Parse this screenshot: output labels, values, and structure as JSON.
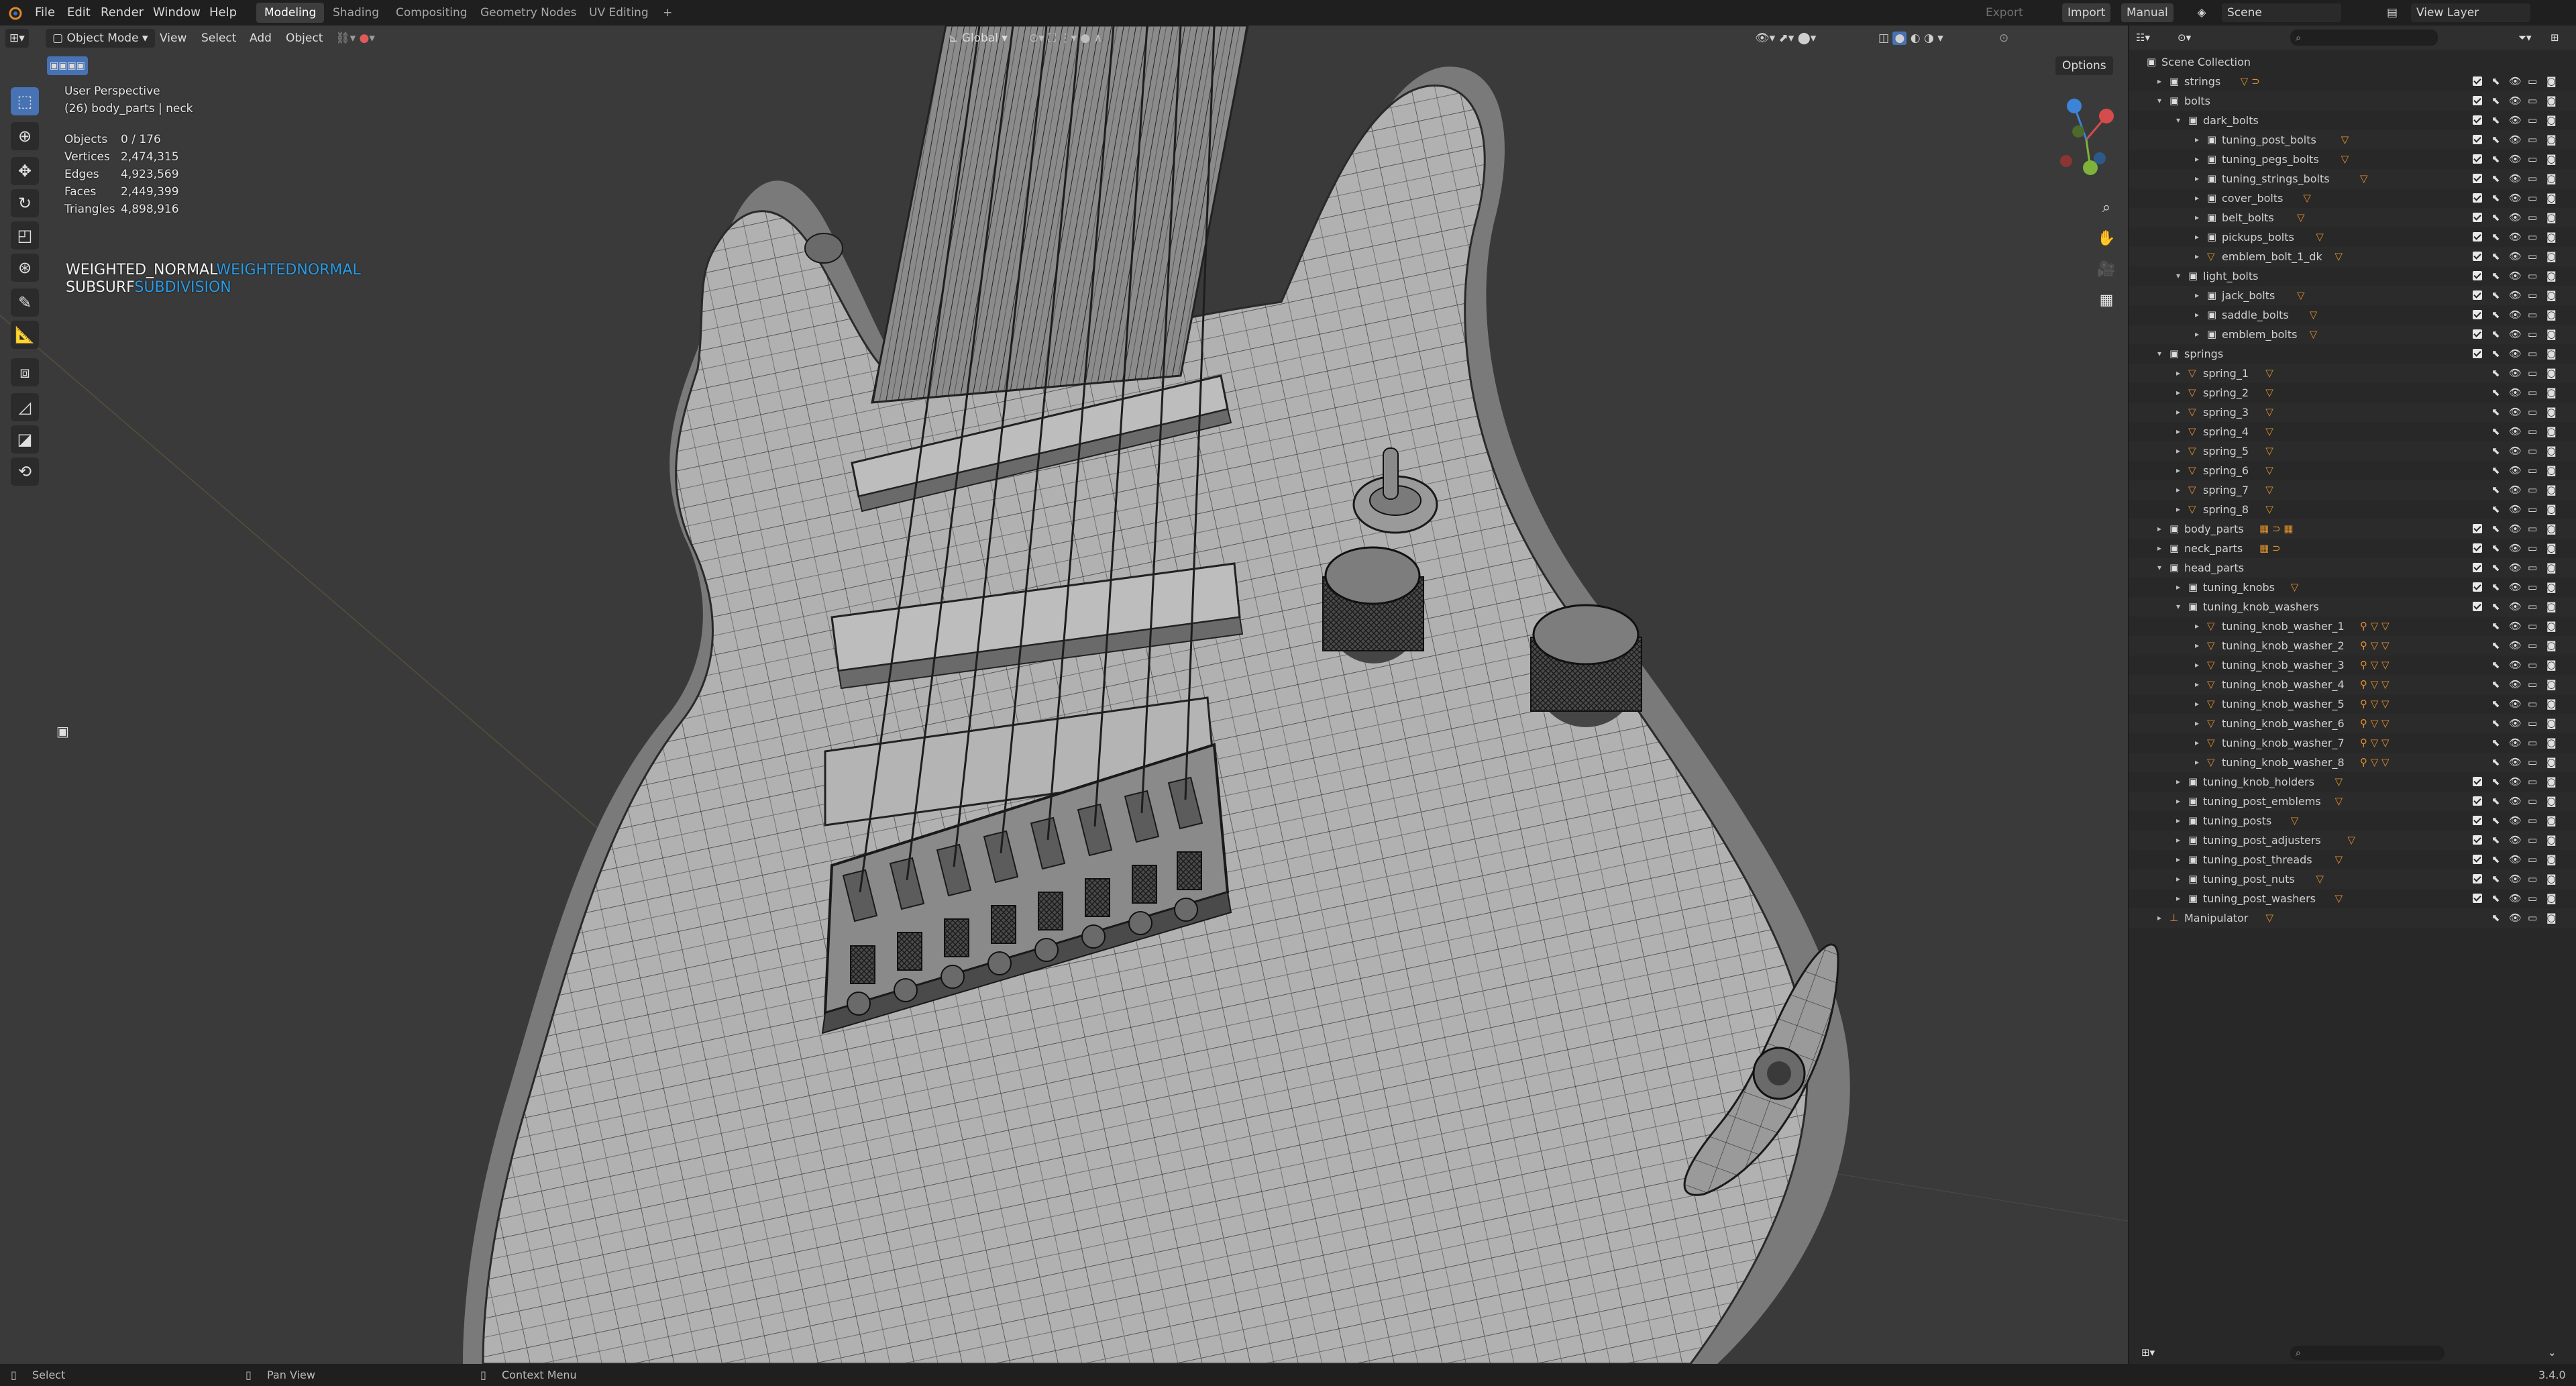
{
  "topbar": {
    "menus": [
      "File",
      "Edit",
      "Render",
      "Window",
      "Help"
    ],
    "workspaces": [
      "Modeling",
      "Shading",
      "Compositing",
      "Geometry Nodes",
      "UV Editing"
    ],
    "active_workspace": "Modeling",
    "add_tab": "+",
    "export_label": "Export",
    "import_label": "Import",
    "manual_label": "Manual",
    "scene_label": "Scene",
    "viewlayer_label": "View Layer"
  },
  "viewport_header": {
    "mode": "Object Mode",
    "menus": [
      "View",
      "Select",
      "Add",
      "Object"
    ],
    "orientation": "Global",
    "options_label": "Options"
  },
  "viewport_overlay": {
    "perspective": "User Perspective",
    "collection_info": "(26) body_parts | neck",
    "stats": [
      {
        "label": "Objects",
        "value": "0 / 176"
      },
      {
        "label": "Vertices",
        "value": "2,474,315"
      },
      {
        "label": "Edges",
        "value": "4,923,569"
      },
      {
        "label": "Faces",
        "value": "2,449,399"
      },
      {
        "label": "Triangles",
        "value": "4,898,916"
      }
    ],
    "modifiers": [
      {
        "name": "WEIGHTED_NORMAL",
        "type": "WEIGHTEDNORMAL"
      },
      {
        "name": "SUBSURF",
        "type": "SUBDIVISION"
      }
    ]
  },
  "outliner": {
    "root": "Scene Collection",
    "rows": [
      {
        "label": "strings",
        "depth": 0,
        "arrow": "▸",
        "icon": "collection",
        "badges": "▽ ⊃",
        "checkbox": true
      },
      {
        "label": "bolts",
        "depth": 0,
        "arrow": "▾",
        "icon": "collection",
        "badges": "",
        "checkbox": true
      },
      {
        "label": "dark_bolts",
        "depth": 1,
        "arrow": "▾",
        "icon": "collection",
        "badges": "",
        "checkbox": true
      },
      {
        "label": "tuning_post_bolts",
        "depth": 2,
        "arrow": "▸",
        "icon": "collection",
        "badges": "▽",
        "checkbox": true
      },
      {
        "label": "tuning_pegs_bolts",
        "depth": 2,
        "arrow": "▸",
        "icon": "collection",
        "badges": "▽",
        "checkbox": true
      },
      {
        "label": "tuning_strings_bolts",
        "depth": 2,
        "arrow": "▸",
        "icon": "collection",
        "badges": "▽",
        "checkbox": true
      },
      {
        "label": "cover_bolts",
        "depth": 2,
        "arrow": "▸",
        "icon": "collection",
        "badges": "▽",
        "checkbox": true
      },
      {
        "label": "belt_bolts",
        "depth": 2,
        "arrow": "▸",
        "icon": "collection",
        "badges": "▽",
        "checkbox": true
      },
      {
        "label": "pickups_bolts",
        "depth": 2,
        "arrow": "▸",
        "icon": "collection",
        "badges": "▽",
        "checkbox": true
      },
      {
        "label": "emblem_bolt_1_dk",
        "depth": 2,
        "arrow": "▸",
        "icon": "mesh",
        "badges": "▽",
        "checkbox": true
      },
      {
        "label": "light_bolts",
        "depth": 1,
        "arrow": "▾",
        "icon": "collection",
        "badges": "",
        "checkbox": true
      },
      {
        "label": "jack_bolts",
        "depth": 2,
        "arrow": "▸",
        "icon": "collection",
        "badges": "▽",
        "checkbox": true
      },
      {
        "label": "saddle_bolts",
        "depth": 2,
        "arrow": "▸",
        "icon": "collection",
        "badges": "▽",
        "checkbox": true
      },
      {
        "label": "emblem_bolts",
        "depth": 2,
        "arrow": "▸",
        "icon": "collection",
        "badges": "▽",
        "checkbox": true
      },
      {
        "label": "springs",
        "depth": 0,
        "arrow": "▾",
        "icon": "collection",
        "badges": "",
        "checkbox": true
      },
      {
        "label": "spring_1",
        "depth": 1,
        "arrow": "▸",
        "icon": "mesh",
        "badges": "▽",
        "checkbox": false
      },
      {
        "label": "spring_2",
        "depth": 1,
        "arrow": "▸",
        "icon": "mesh",
        "badges": "▽",
        "checkbox": false
      },
      {
        "label": "spring_3",
        "depth": 1,
        "arrow": "▸",
        "icon": "mesh",
        "badges": "▽",
        "checkbox": false
      },
      {
        "label": "spring_4",
        "depth": 1,
        "arrow": "▸",
        "icon": "mesh",
        "badges": "▽",
        "checkbox": false
      },
      {
        "label": "spring_5",
        "depth": 1,
        "arrow": "▸",
        "icon": "mesh",
        "badges": "▽",
        "checkbox": false
      },
      {
        "label": "spring_6",
        "depth": 1,
        "arrow": "▸",
        "icon": "mesh",
        "badges": "▽",
        "checkbox": false
      },
      {
        "label": "spring_7",
        "depth": 1,
        "arrow": "▸",
        "icon": "mesh",
        "badges": "▽",
        "checkbox": false
      },
      {
        "label": "spring_8",
        "depth": 1,
        "arrow": "▸",
        "icon": "mesh",
        "badges": "▽",
        "checkbox": false
      },
      {
        "label": "body_parts",
        "depth": 0,
        "arrow": "▸",
        "icon": "collection",
        "badges": "▦ ⊃ ▦",
        "checkbox": true
      },
      {
        "label": "neck_parts",
        "depth": 0,
        "arrow": "▸",
        "icon": "collection",
        "badges": "▦ ⊃",
        "checkbox": true
      },
      {
        "label": "head_parts",
        "depth": 0,
        "arrow": "▾",
        "icon": "collection",
        "badges": "",
        "checkbox": true
      },
      {
        "label": "tuning_knobs",
        "depth": 1,
        "arrow": "▸",
        "icon": "collection",
        "badges": "▽",
        "checkbox": true
      },
      {
        "label": "tuning_knob_washers",
        "depth": 1,
        "arrow": "▾",
        "icon": "collection",
        "badges": "",
        "checkbox": true
      },
      {
        "label": "tuning_knob_washer_1",
        "depth": 2,
        "arrow": "▸",
        "icon": "mesh",
        "badges": "⚲ ▽ ▽",
        "checkbox": false
      },
      {
        "label": "tuning_knob_washer_2",
        "depth": 2,
        "arrow": "▸",
        "icon": "mesh",
        "badges": "⚲ ▽ ▽",
        "checkbox": false
      },
      {
        "label": "tuning_knob_washer_3",
        "depth": 2,
        "arrow": "▸",
        "icon": "mesh",
        "badges": "⚲ ▽ ▽",
        "checkbox": false
      },
      {
        "label": "tuning_knob_washer_4",
        "depth": 2,
        "arrow": "▸",
        "icon": "mesh",
        "badges": "⚲ ▽ ▽",
        "checkbox": false
      },
      {
        "label": "tuning_knob_washer_5",
        "depth": 2,
        "arrow": "▸",
        "icon": "mesh",
        "badges": "⚲ ▽ ▽",
        "checkbox": false
      },
      {
        "label": "tuning_knob_washer_6",
        "depth": 2,
        "arrow": "▸",
        "icon": "mesh",
        "badges": "⚲ ▽ ▽",
        "checkbox": false
      },
      {
        "label": "tuning_knob_washer_7",
        "depth": 2,
        "arrow": "▸",
        "icon": "mesh",
        "badges": "⚲ ▽ ▽",
        "checkbox": false
      },
      {
        "label": "tuning_knob_washer_8",
        "depth": 2,
        "arrow": "▸",
        "icon": "mesh",
        "badges": "⚲ ▽ ▽",
        "checkbox": false
      },
      {
        "label": "tuning_knob_holders",
        "depth": 1,
        "arrow": "▸",
        "icon": "collection",
        "badges": "▽",
        "checkbox": true
      },
      {
        "label": "tuning_post_emblems",
        "depth": 1,
        "arrow": "▸",
        "icon": "collection",
        "badges": "▽",
        "checkbox": true
      },
      {
        "label": "tuning_posts",
        "depth": 1,
        "arrow": "▸",
        "icon": "collection",
        "badges": "▽",
        "checkbox": true
      },
      {
        "label": "tuning_post_adjusters",
        "depth": 1,
        "arrow": "▸",
        "icon": "collection",
        "badges": "▽",
        "checkbox": true
      },
      {
        "label": "tuning_post_threads",
        "depth": 1,
        "arrow": "▸",
        "icon": "collection",
        "badges": "▽",
        "checkbox": true
      },
      {
        "label": "tuning_post_nuts",
        "depth": 1,
        "arrow": "▸",
        "icon": "collection",
        "badges": "▽",
        "checkbox": true
      },
      {
        "label": "tuning_post_washers",
        "depth": 1,
        "arrow": "▸",
        "icon": "collection",
        "badges": "▽",
        "checkbox": true
      },
      {
        "label": "Manipulator",
        "depth": 0,
        "arrow": "▸",
        "icon": "armature",
        "badges": "▽",
        "checkbox": false
      }
    ]
  },
  "statusbar": {
    "select": "Select",
    "pan": "Pan View",
    "context": "Context Menu",
    "version": "3.4.0"
  },
  "colors": {
    "accent": "#4772b3",
    "modifier_type": "#2b9be3",
    "viewport_bg": "#3a3a3a",
    "mesh_fill": "#a9a9a9",
    "wire": "#2e2e2e"
  }
}
